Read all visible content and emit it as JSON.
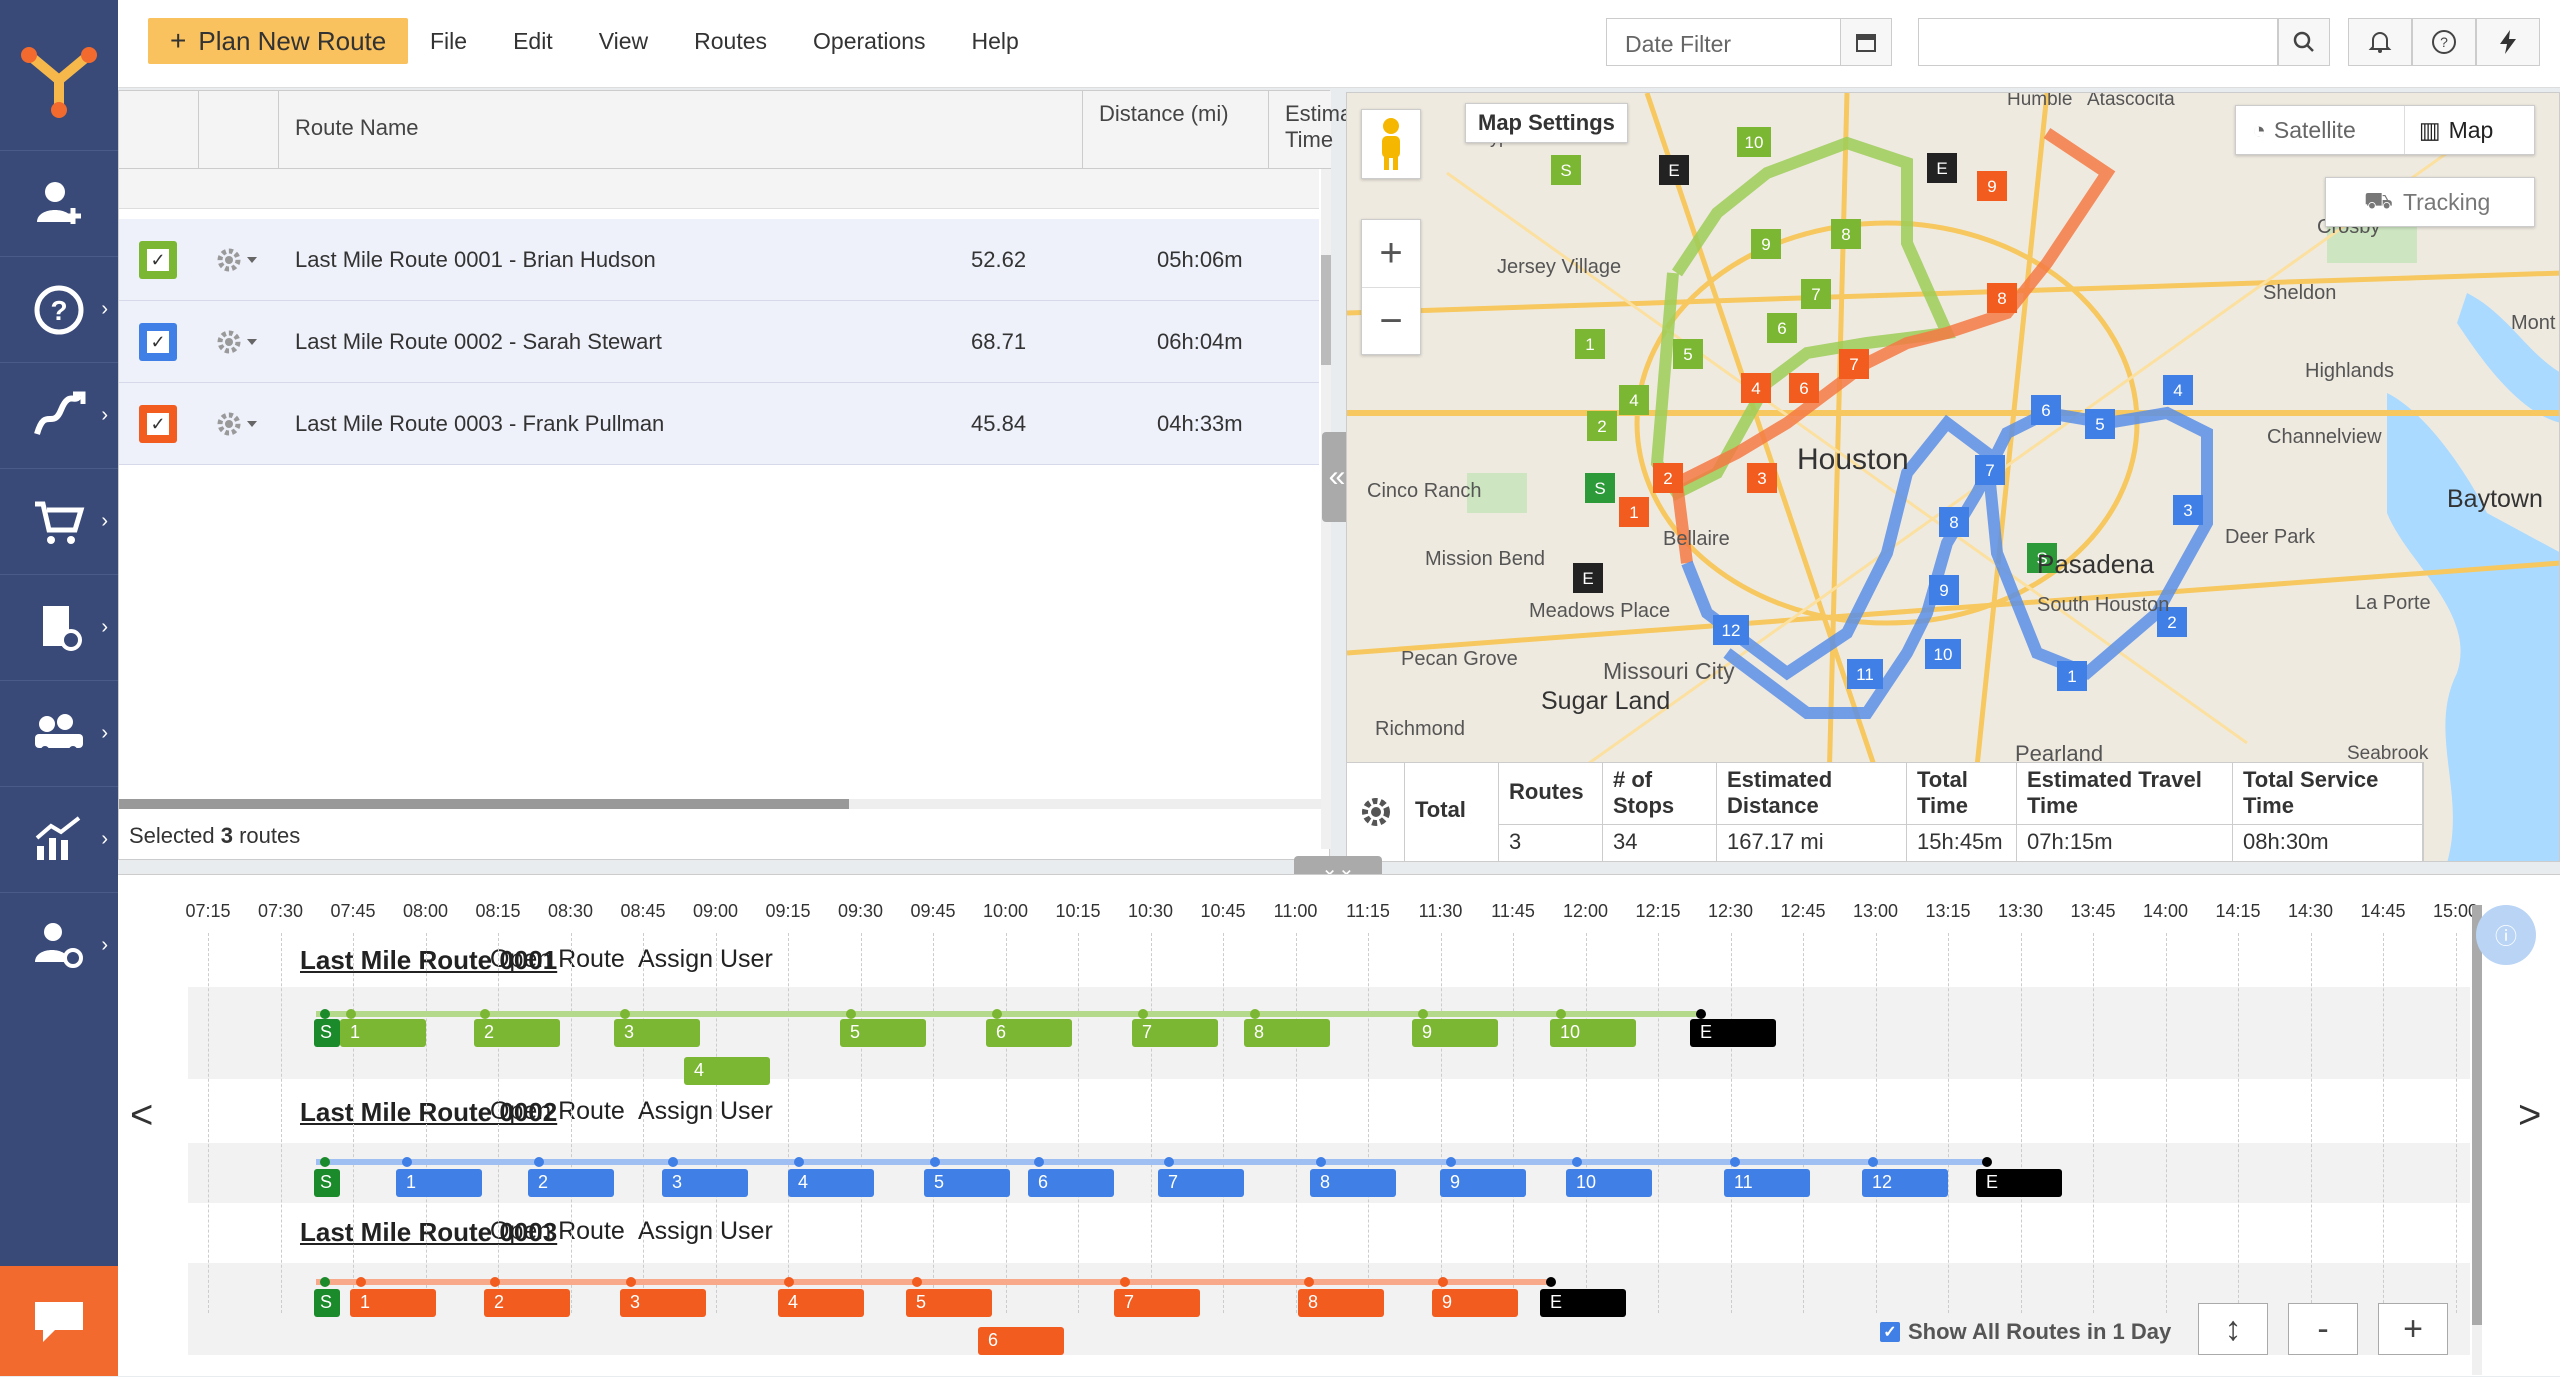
{
  "header": {
    "plan_button": "Plan New Route",
    "menu": [
      "File",
      "Edit",
      "View",
      "Routes",
      "Operations",
      "Help"
    ],
    "date_filter_placeholder": "Date Filter"
  },
  "routes_grid": {
    "columns": [
      "Route Name",
      "Distance (mi)",
      "Estimated Time"
    ],
    "rows": [
      {
        "name": "Last Mile Route 0001 - Brian Hudson",
        "distance": "52.62",
        "time": "05h:06m",
        "color": "#7cb733"
      },
      {
        "name": "Last Mile Route 0002 - Sarah Stewart",
        "distance": "68.71",
        "time": "06h:04m",
        "color": "#3f7fe6"
      },
      {
        "name": "Last Mile Route 0003 - Frank Pullman",
        "distance": "45.84",
        "time": "04h:33m",
        "color": "#f25c1f"
      }
    ],
    "selected_prefix": "Selected ",
    "selected_count": "3",
    "selected_suffix": " routes"
  },
  "map": {
    "settings_label": "Map Settings",
    "satellite_label": "Satellite",
    "map_label": "Map",
    "tracking_label": "Tracking",
    "places": [
      "Humble",
      "Atascocita",
      "Cypress",
      "Jersey Village",
      "Crosby",
      "Sheldon",
      "Mont",
      "Highlands",
      "Channelview",
      "Baytown",
      "Cinco Ranch",
      "Bellaire",
      "Houston",
      "Deer Park",
      "Mission Bend",
      "Pasadena",
      "Meadows Place",
      "South Houston",
      "La Porte",
      "Pecan Grove",
      "Missouri City",
      "Sugar Land",
      "Richmond",
      "Pearland",
      "Seabrook"
    ]
  },
  "totals": {
    "label": "Total",
    "headers": [
      "Routes",
      "# of Stops",
      "Estimated Distance",
      "Total Time",
      "Estimated Travel Time",
      "Total Service Time"
    ],
    "values": [
      "3",
      "34",
      "167.17 mi",
      "15h:45m",
      "07h:15m",
      "08h:30m"
    ]
  },
  "timeline": {
    "ticks": [
      "07:15",
      "07:30",
      "07:45",
      "08:00",
      "08:15",
      "08:30",
      "08:45",
      "09:00",
      "09:15",
      "09:30",
      "09:45",
      "10:00",
      "10:15",
      "10:30",
      "10:45",
      "11:00",
      "11:15",
      "11:30",
      "11:45",
      "12:00",
      "12:15",
      "12:30",
      "12:45",
      "13:00",
      "13:15",
      "13:30",
      "13:45",
      "14:00",
      "14:15",
      "14:30",
      "14:45",
      "15:00"
    ],
    "routes": [
      {
        "title": "Last Mile Route 0001",
        "open": "Open Route",
        "assign": "Assign User",
        "color": "#7cb733",
        "light": "#b5d98a"
      },
      {
        "title": "Last Mile Route 0002",
        "open": "Open Route",
        "assign": "Assign User",
        "color": "#3f7fe6",
        "light": "#9fbff2"
      },
      {
        "title": "Last Mile Route 0003",
        "open": "Open Route",
        "assign": "Assign User",
        "color": "#f25c1f",
        "light": "#f7a98a"
      }
    ],
    "show_all_label": "Show All Routes in 1 Day"
  }
}
